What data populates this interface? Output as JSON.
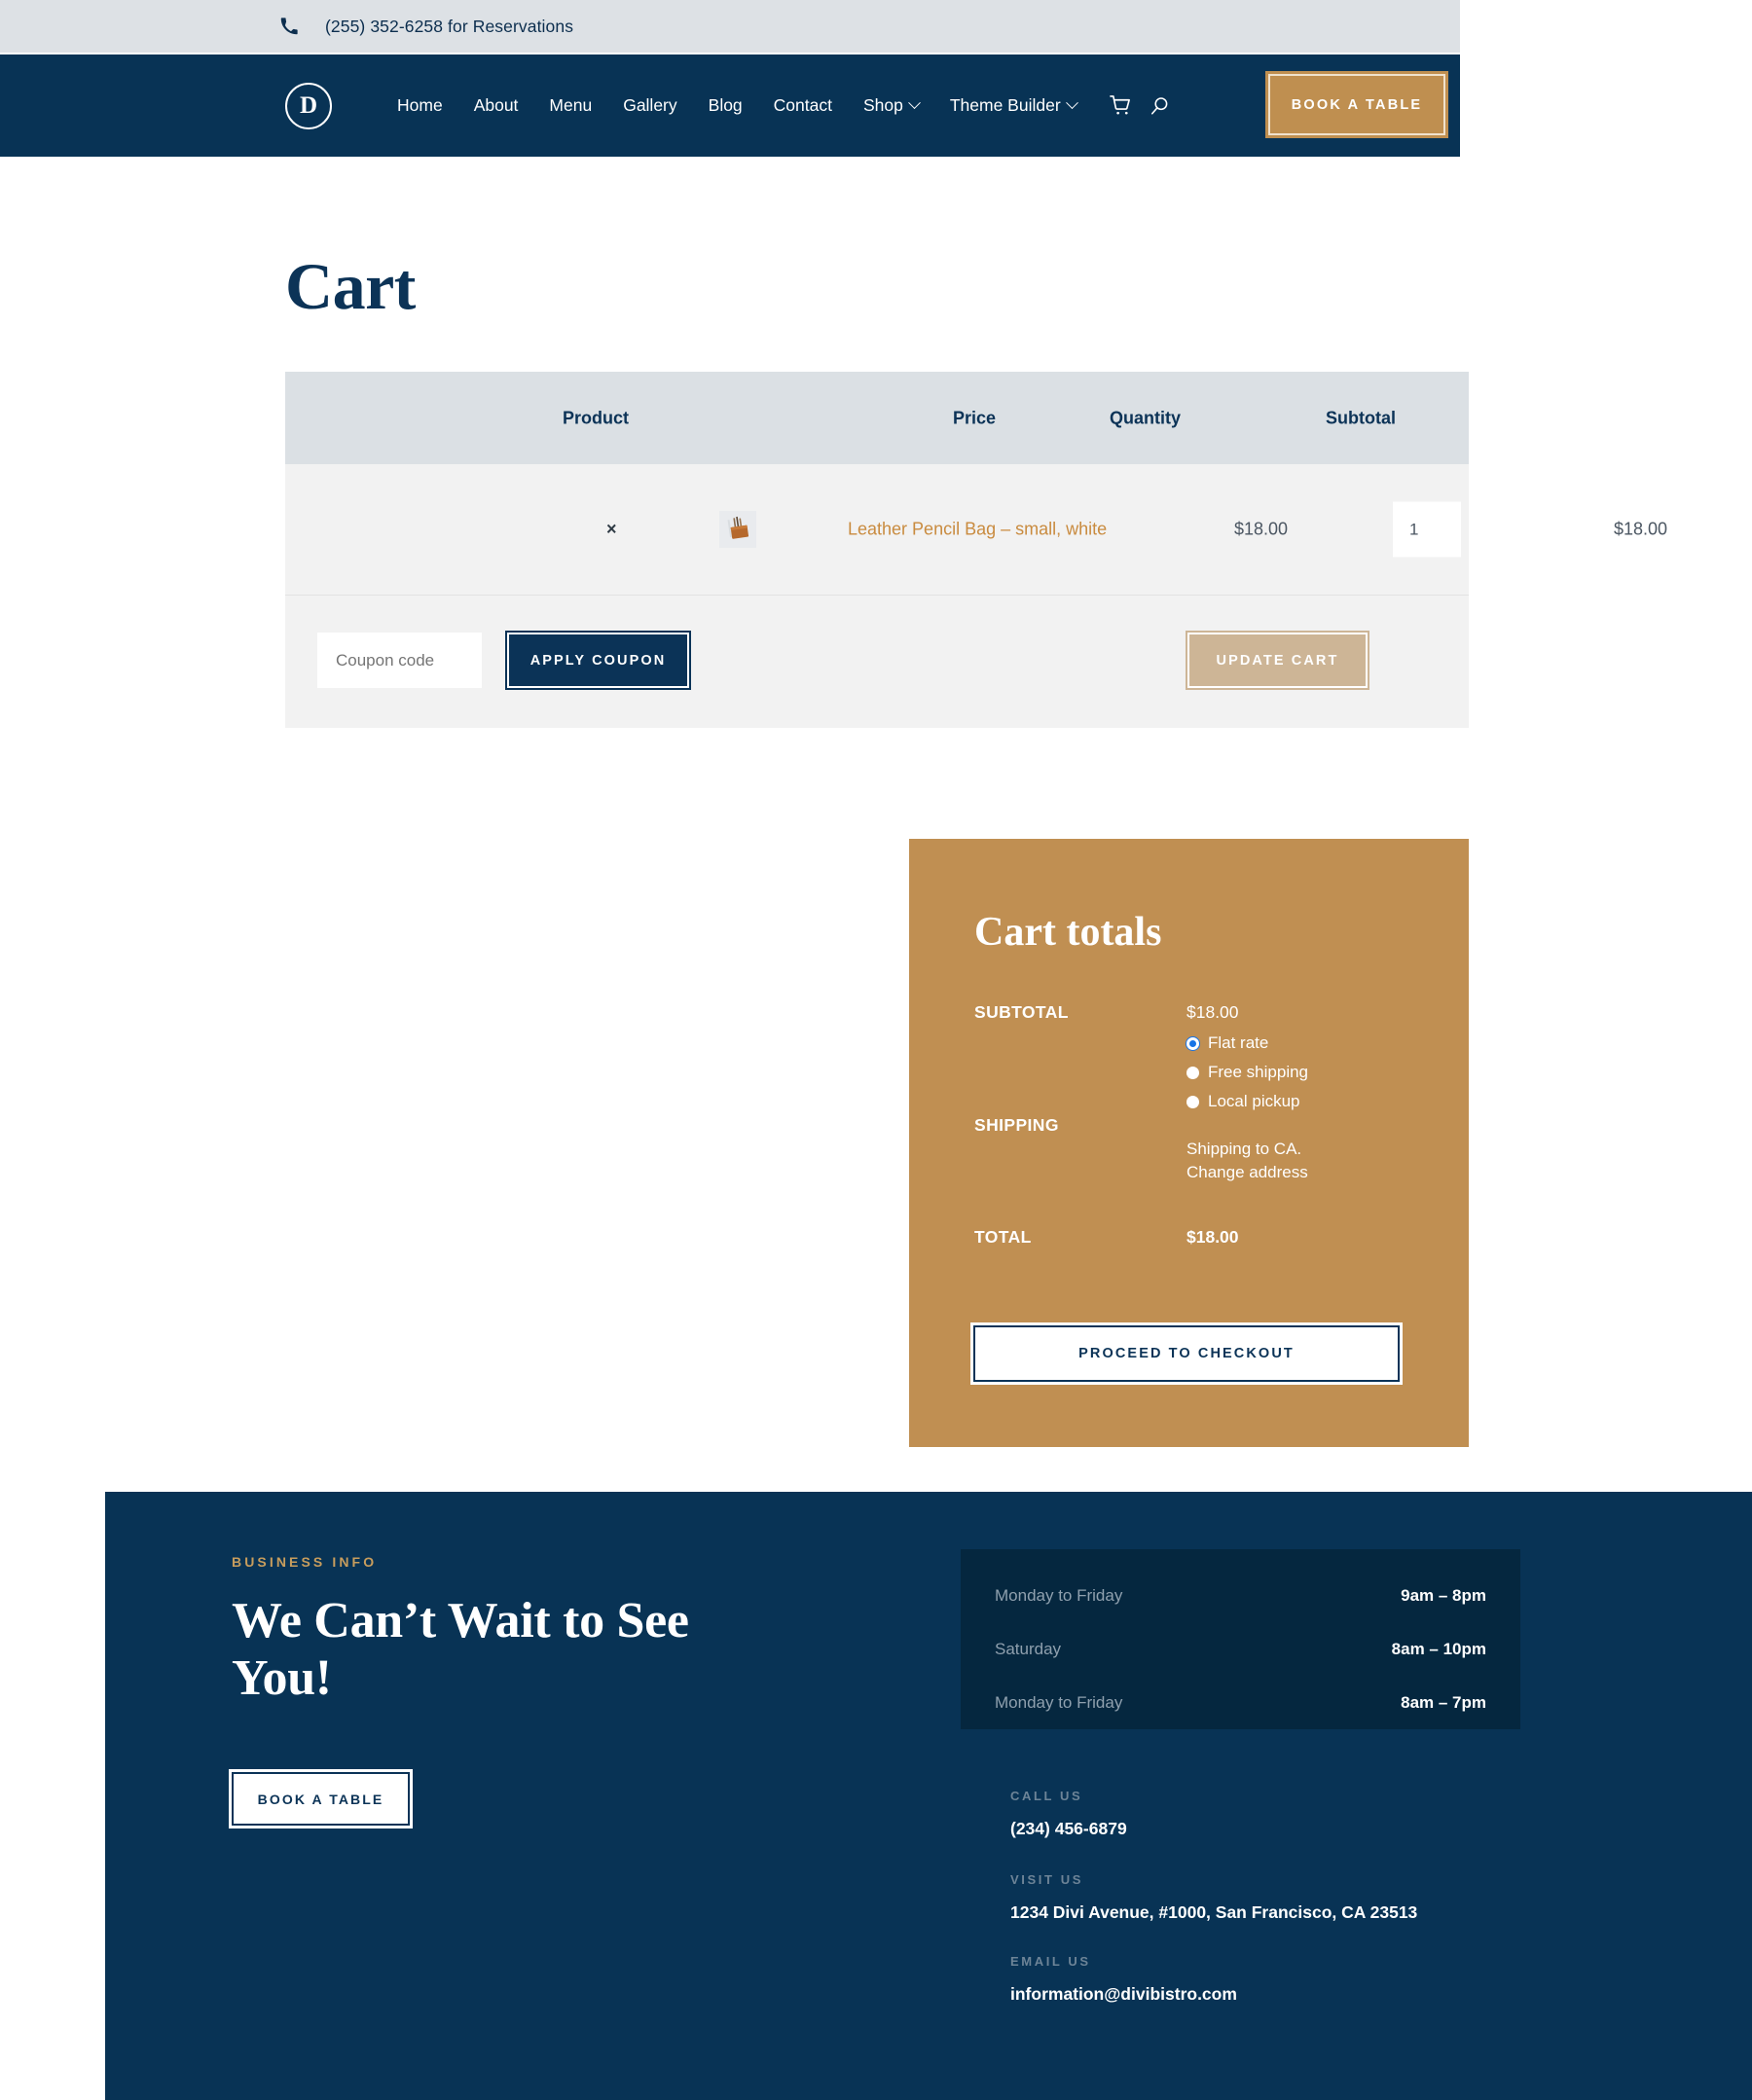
{
  "topbar": {
    "phone_icon": "phone-icon",
    "text": "(255) 352-6258 for Reservations"
  },
  "nav": {
    "logo_letter": "D",
    "items": [
      {
        "label": "Home",
        "has_caret": false
      },
      {
        "label": "About",
        "has_caret": false
      },
      {
        "label": "Menu",
        "has_caret": false
      },
      {
        "label": "Gallery",
        "has_caret": false
      },
      {
        "label": "Blog",
        "has_caret": false
      },
      {
        "label": "Contact",
        "has_caret": false
      },
      {
        "label": "Shop",
        "has_caret": true
      },
      {
        "label": "Theme Builder",
        "has_caret": true
      }
    ],
    "cart_icon": "shopping-cart-icon",
    "search_icon": "search-icon",
    "book_button": "BOOK A TABLE"
  },
  "page": {
    "title": "Cart"
  },
  "cart_table": {
    "headers": {
      "product": "Product",
      "price": "Price",
      "quantity": "Quantity",
      "subtotal": "Subtotal"
    },
    "rows": [
      {
        "remove": "×",
        "thumbnail": "leather-pencil-bag-thumbnail",
        "name": "Leather Pencil Bag – small, white",
        "price": "$18.00",
        "quantity": "1",
        "subtotal": "$18.00"
      }
    ],
    "actions": {
      "coupon_placeholder": "Coupon code",
      "coupon_value": "",
      "apply_coupon": "APPLY COUPON",
      "update_cart": "UPDATE CART"
    }
  },
  "cart_totals": {
    "title": "Cart totals",
    "subtotal_label": "SUBTOTAL",
    "subtotal_value": "$18.00",
    "shipping_label": "SHIPPING",
    "shipping_options": [
      {
        "label": "Flat rate",
        "selected": true
      },
      {
        "label": "Free shipping",
        "selected": false
      },
      {
        "label": "Local pickup",
        "selected": false
      }
    ],
    "shipping_to": "Shipping to CA.",
    "change_address": "Change address",
    "total_label": "TOTAL",
    "total_value": "$18.00",
    "checkout_button": "PROCEED TO CHECKOUT"
  },
  "footer": {
    "eyebrow": "BUSINESS INFO",
    "heading": "We Can’t Wait to See You!",
    "book_button": "BOOK A TABLE",
    "hours": [
      {
        "day": "Monday to Friday",
        "time": "9am – 8pm"
      },
      {
        "day": "Saturday",
        "time": "8am – 10pm"
      },
      {
        "day": "Monday to Friday",
        "time": "8am – 7pm"
      }
    ],
    "contact": {
      "call_label": "CALL US",
      "call_value": "(234) 456-6879",
      "visit_label": "VISIT US",
      "visit_value": "1234 Divi Avenue, #1000, San Francisco, CA 23513",
      "email_label": "EMAIL US",
      "email_value": "information@divibistro.com"
    }
  },
  "colors": {
    "navy": "#083355",
    "gold": "#c08f52",
    "topbar_gray": "#dde1e5",
    "table_header": "#dbe0e4",
    "table_row": "#f2f2f2",
    "link_gold": "#c98b3f",
    "footer_dark": "#05273f"
  }
}
